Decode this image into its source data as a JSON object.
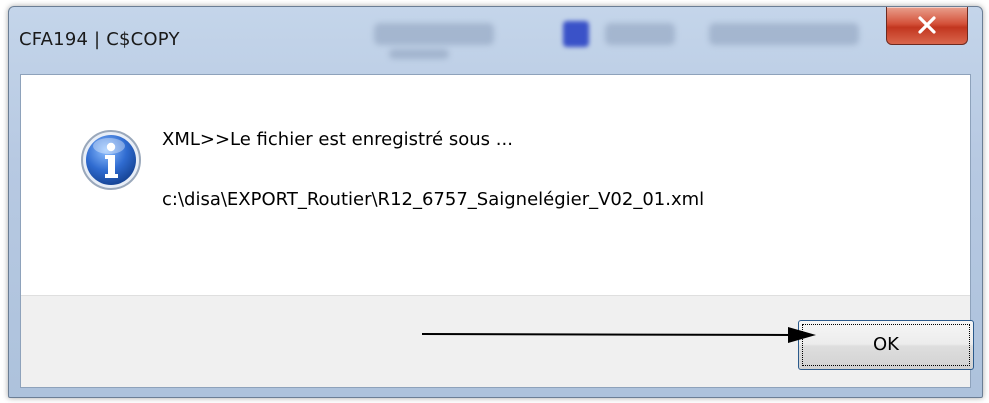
{
  "window": {
    "title": "CFA194 | C$COPY",
    "close_label": "X"
  },
  "dialog": {
    "icon": "information-icon",
    "message_line1": "XML>>Le fichier est enregistré sous ...",
    "message_line2": "c:\\disa\\EXPORT_Routier\\R12_6757_Saignelégier_V02_01.xml",
    "ok_label": "OK"
  },
  "annotation": {
    "icon": "arrow-right-icon"
  },
  "colors": {
    "close_button": "#c2361f",
    "info_icon": "#2f6bd0",
    "focus_border": "#2a5a8c"
  }
}
